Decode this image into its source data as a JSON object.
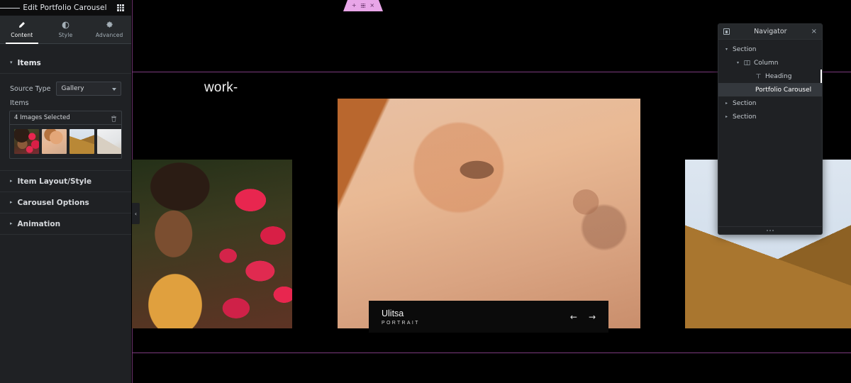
{
  "panel": {
    "header": {
      "burger_icon": "hamburger-menu-icon",
      "title": "Edit Portfolio Carousel",
      "grid_icon": "apps-grid-icon"
    },
    "tabs": [
      {
        "label": "Content",
        "icon": "pencil-icon",
        "active": true
      },
      {
        "label": "Style",
        "icon": "contrast-half-circle-icon",
        "active": false
      },
      {
        "label": "Advanced",
        "icon": "gear-icon",
        "active": false
      }
    ],
    "sections": [
      {
        "label": "Items",
        "open": true
      },
      {
        "label": "Item Layout/Style",
        "open": false
      },
      {
        "label": "Carousel Options",
        "open": false
      },
      {
        "label": "Animation",
        "open": false
      }
    ],
    "controls": {
      "source_type_label": "Source Type",
      "source_type_value": "Gallery",
      "source_type_options": [
        "Gallery"
      ],
      "items_label": "Items",
      "gallery_summary": "4 Images Selected",
      "gallery_delete_icon": "trash-icon",
      "thumbnails": [
        {
          "name": "thumbnail-flowers",
          "art": "th-flowers"
        },
        {
          "name": "thumbnail-portrait",
          "art": "th-portrait"
        },
        {
          "name": "thumbnail-pyramid",
          "art": "th-pyramid"
        },
        {
          "name": "thumbnail-architecture",
          "art": "th-arch"
        }
      ]
    },
    "collapse_arrow": "‹"
  },
  "canvas": {
    "heading": "work-",
    "widget_handle": {
      "add_icon": "+",
      "drag_icon": "drag-dots-icon",
      "close_icon": "×"
    },
    "caption": {
      "title": "Ulitsa",
      "subtitle": "PORTRAIT",
      "prev_arrow": "←",
      "next_arrow": "→"
    },
    "accent_color": "#7c3a7e",
    "handle_color": "#e8a6e8"
  },
  "navigator": {
    "dock_icon": "dock-panel-icon",
    "title": "Navigator",
    "close_icon": "×",
    "resize_icon": "resize-grip-icon",
    "tree": [
      {
        "label": "Section",
        "depth": 0,
        "caret": "▾",
        "icon": "",
        "selected": false,
        "marker": false
      },
      {
        "label": "Column",
        "depth": 1,
        "caret": "▾",
        "icon": "column-icon",
        "selected": false,
        "marker": false
      },
      {
        "label": "Heading",
        "depth": 2,
        "caret": "",
        "icon": "heading-t-icon",
        "selected": false,
        "marker": true
      },
      {
        "label": "Portfolio Carousel",
        "depth": 2,
        "caret": "",
        "icon": "",
        "selected": true,
        "marker": false
      },
      {
        "label": "Section",
        "depth": 0,
        "caret": "▸",
        "icon": "",
        "selected": false,
        "marker": false
      },
      {
        "label": "Section",
        "depth": 0,
        "caret": "▸",
        "icon": "",
        "selected": false,
        "marker": false
      }
    ]
  }
}
